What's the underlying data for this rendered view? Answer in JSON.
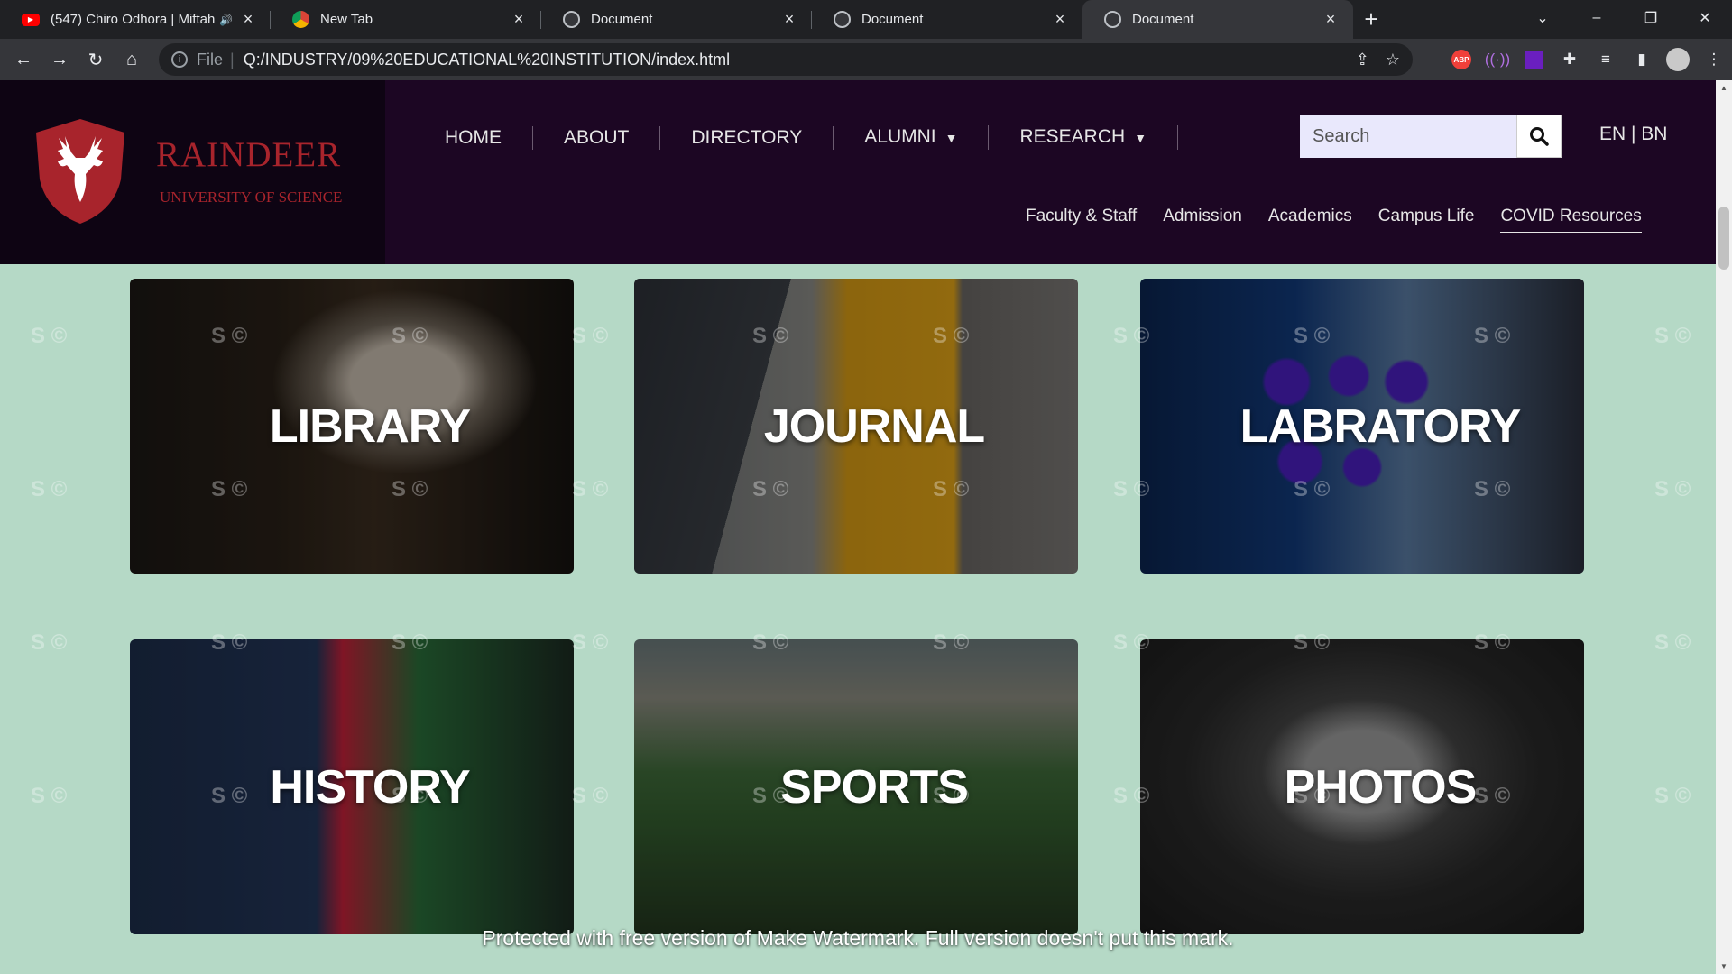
{
  "browser": {
    "tabs": [
      {
        "title": "(547) Chiro Odhora | Miftah",
        "favicon": "youtube-icon",
        "active": false
      },
      {
        "title": "New Tab",
        "favicon": "chrome-icon",
        "active": false
      },
      {
        "title": "Document",
        "favicon": "globe-icon",
        "active": false
      },
      {
        "title": "Document",
        "favicon": "globe-icon",
        "active": false
      },
      {
        "title": "Document",
        "favicon": "globe-icon",
        "active": true
      }
    ],
    "address": {
      "scheme_label": "File",
      "url": "Q:/INDUSTRY/09%20EDUCATIONAL%20INSTITUTION/index.html"
    },
    "extensions": {
      "abp_label": "ABP"
    }
  },
  "site": {
    "brand": {
      "name": "RAINDEER",
      "subtitle": "UNIVERSITY OF SCIENCE"
    },
    "nav": [
      "HOME",
      "ABOUT",
      "DIRECTORY",
      "ALUMNI",
      "RESEARCH"
    ],
    "search": {
      "placeholder": "Search"
    },
    "language": "EN | BN",
    "subnav": [
      "Faculty & Staff",
      "Admission",
      "Academics",
      "Campus Life",
      "COVID Resources"
    ],
    "cards": [
      {
        "label": "LIBRARY"
      },
      {
        "label": "JOURNAL"
      },
      {
        "label": "LABRATORY"
      },
      {
        "label": "HISTORY"
      },
      {
        "label": "SPORTS"
      },
      {
        "label": "PHOTOS"
      }
    ],
    "watermark": {
      "mark": "S ©",
      "footer": "Protected with free version of Make Watermark. Full version doesn't put this mark."
    }
  },
  "colors": {
    "page_bg": "#b5d9c6",
    "header_bg": "#1c0623",
    "brand_red": "#a8242c"
  }
}
